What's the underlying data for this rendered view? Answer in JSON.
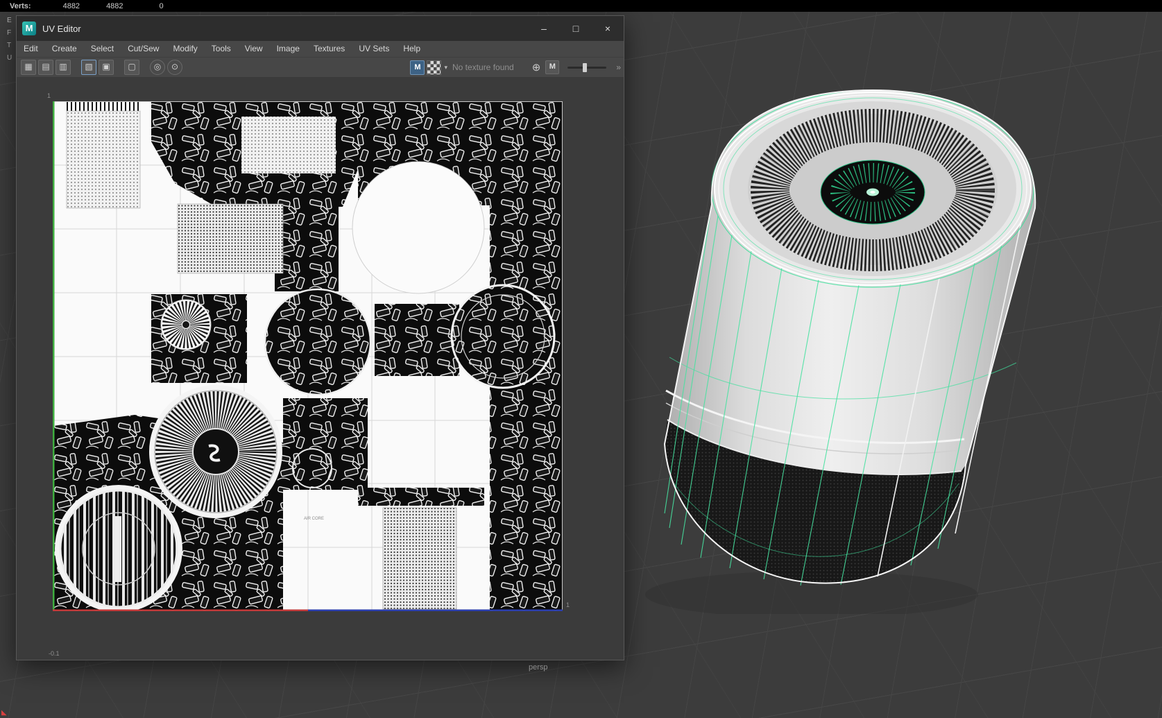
{
  "hud": {
    "verts_label": "Verts:",
    "counts": [
      "4882",
      "4882",
      "0"
    ],
    "side_labels": [
      "E",
      "F",
      "T",
      "U"
    ]
  },
  "viewport": {
    "camera_label": "persp"
  },
  "window": {
    "title": "UV Editor",
    "menus": [
      "Edit",
      "Create",
      "Select",
      "Cut/Sew",
      "Modify",
      "Tools",
      "View",
      "Image",
      "Textures",
      "UV Sets",
      "Help"
    ],
    "toolbar": {
      "texture_status": "No texture found"
    },
    "canvas": {
      "tick_top": "1",
      "tick_bottom_left": "-0.1",
      "tick_bottom_right": "1",
      "texture_label": "AIR CORE"
    }
  },
  "icons": {
    "maya_logo": "M",
    "minimize": "–",
    "maximize": "□",
    "close": "×",
    "image": "M",
    "caret": "▾",
    "globe": "⊕",
    "material": "M",
    "expand": "»",
    "axis": "◣",
    "toolbar": [
      "▦",
      "▤",
      "▥",
      "▧",
      "▣",
      "▢",
      "◎",
      "⊙"
    ]
  },
  "colors": {
    "accent_green": "#3fe09c",
    "maya_teal": "#0b7f86"
  }
}
